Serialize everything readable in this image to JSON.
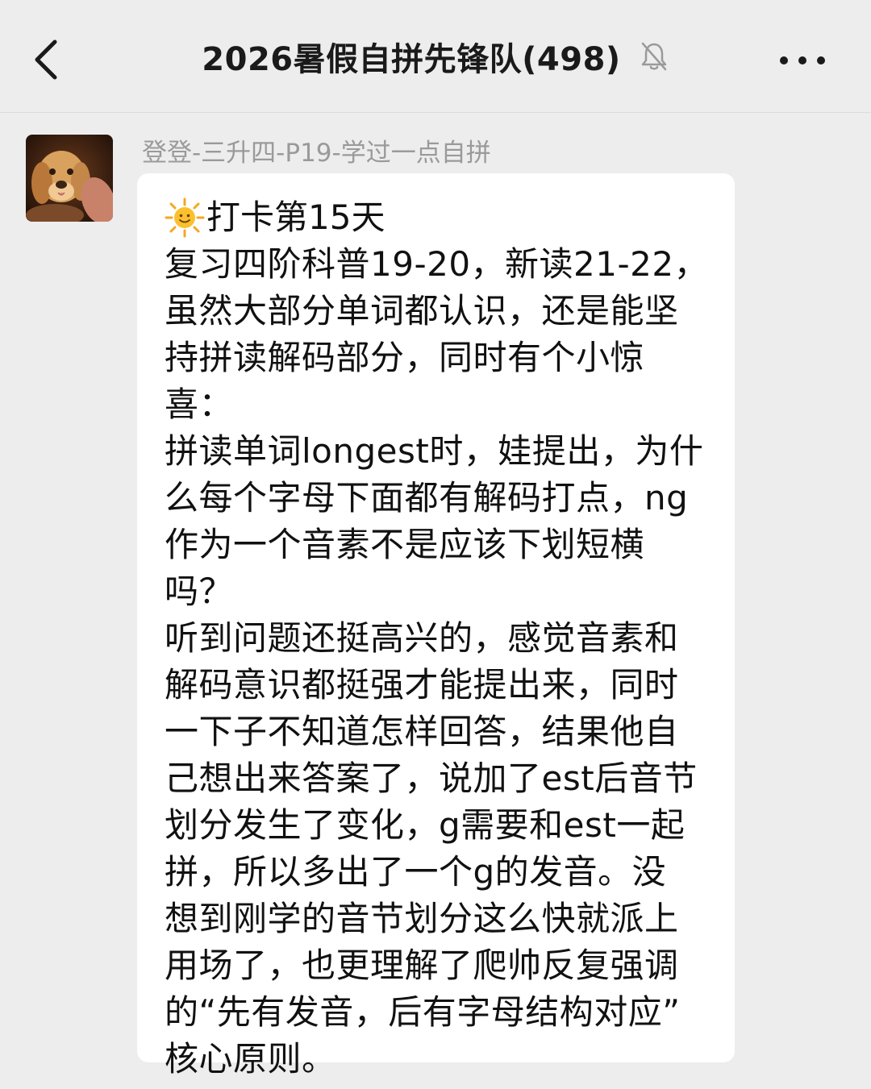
{
  "header": {
    "title": "2026暑假自拼先锋队(498)",
    "back_icon": "chevron-left-icon",
    "mute_icon": "bell-muted-icon",
    "more_icon": "more-dots-icon"
  },
  "message": {
    "sender_name": "登登-三升四-P19-学过一点自拼",
    "avatar_icon": "dog-avatar",
    "emoji_icon": "sun-emoji",
    "title": "打卡第15天",
    "body": "复习四阶科普19-20，新读21-22，\n虽然大部分单词都认识，还是能坚\n持拼读解码部分，同时有个小惊\n喜：\n拼读单词longest时，娃提出，为什\n么每个字母下面都有解码打点，ng\n作为一个音素不是应该下划短横吗？\n听到问题还挺高兴的，感觉音素和\n解码意识都挺强才能提出来，同时\n一下子不知道怎样回答，结果他自\n己想出来答案了，说加了est后音节\n划分发生了变化，g需要和est一起\n拼，所以多出了一个g的发音。没\n想到刚学的音节划分这么快就派上\n用场了，也更理解了爬帅反复强调\n的“先有发音，后有字母结构对应”\n核心原则。"
  },
  "colors": {
    "background": "#ededed",
    "bubble": "#ffffff",
    "sender_name": "#9a9a9a",
    "text": "#111111"
  }
}
